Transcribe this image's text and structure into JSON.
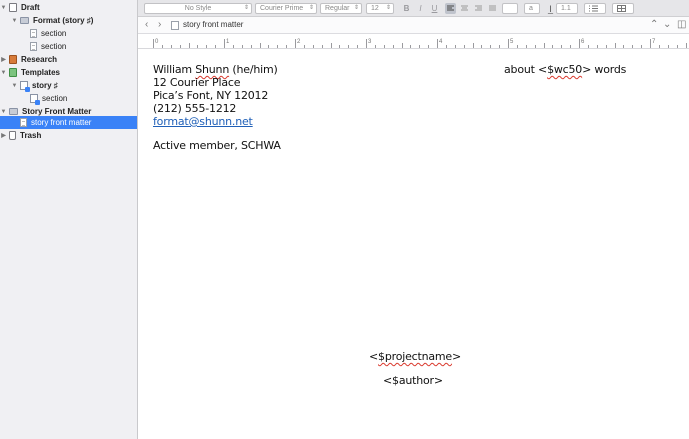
{
  "binder": {
    "items": [
      {
        "label": "Draft"
      },
      {
        "label": "Format (story ♯)"
      },
      {
        "label": "section"
      },
      {
        "label": "section"
      },
      {
        "label": "Research"
      },
      {
        "label": "Templates"
      },
      {
        "label": "story ♯"
      },
      {
        "label": "section"
      },
      {
        "label": "Story Front Matter"
      },
      {
        "label": "story front matter"
      },
      {
        "label": "Trash"
      }
    ]
  },
  "toolbar": {
    "style": "No Style",
    "font": "Courier Prime",
    "weight": "Regular",
    "size": "12",
    "bold": "B",
    "italic": "I",
    "underline": "U",
    "text_color": "a",
    "line_spacing": "1.1"
  },
  "header": {
    "doc_title": "story front matter",
    "back": "‹",
    "forward": "›",
    "up": "⌃",
    "down": "⌄",
    "split": "◫"
  },
  "ruler": {
    "labels": [
      "0",
      "1",
      "2",
      "3",
      "4",
      "5",
      "6",
      "7"
    ]
  },
  "document": {
    "name_prefix": "William ",
    "name_sq": "Shunn",
    "name_suffix": " (he/him)",
    "wc_prefix": "about <",
    "wc_sq": "$wc50",
    "wc_suffix": "> words",
    "address1": "12 Courier Place",
    "address2": "Pica’s Font, NY 12012",
    "phone": "(212) 555-1212",
    "email": "format@shunn.net",
    "membership": "Active member, SCHWA",
    "proj_prefix": "<",
    "proj_sq": "$projectname",
    "proj_suffix": ">",
    "author": "<$author>"
  },
  "colors": {
    "selection": "#3a82f7",
    "link": "#2060b8"
  }
}
